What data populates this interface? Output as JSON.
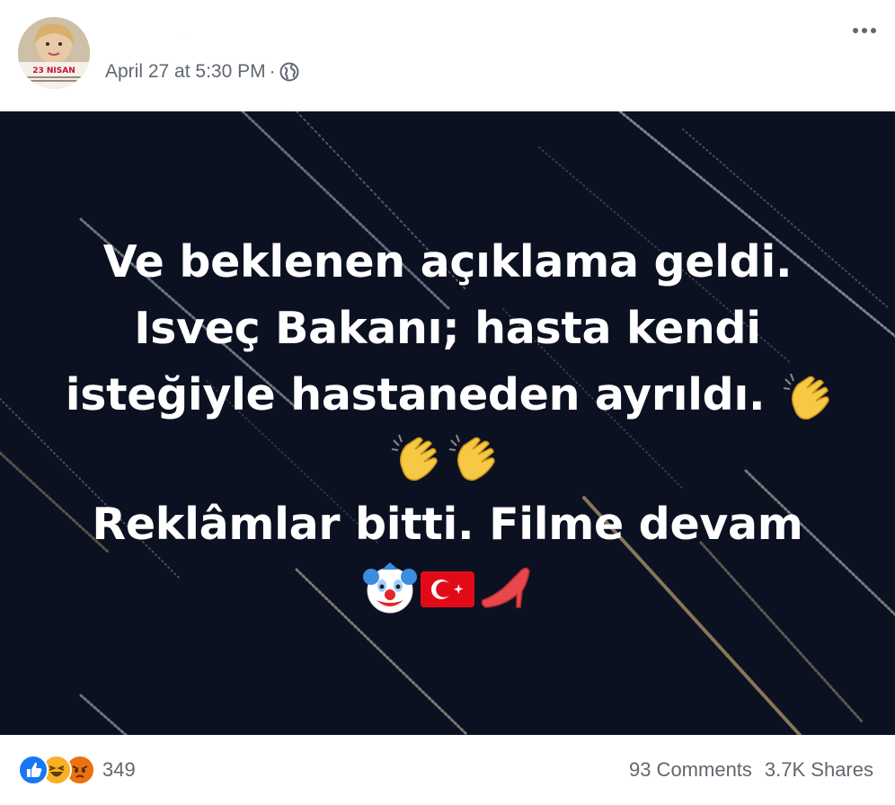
{
  "post": {
    "author_name": "-",
    "timestamp": "April 27 at 5:30 PM",
    "separator": "·",
    "privacy_icon": "globe-icon",
    "avatar_text": "23 NISAN",
    "menu_icon": "more-options-icon"
  },
  "image": {
    "lines": [
      "Ve beklenen açıklama geldi.",
      "Isveç Bakanı; hasta kendi",
      "isteğiyle hastaneden ayrıldı.",
      "Reklâmlar bitti. Filme devam"
    ],
    "emojis": [
      "clapping-hands",
      "clapping-hands",
      "clapping-hands",
      "clown-face",
      "turkey-flag",
      "high-heel"
    ]
  },
  "footer": {
    "reaction_icons": [
      "like-icon",
      "haha-icon",
      "angry-icon"
    ],
    "reaction_count": "349",
    "comments": "93 Comments",
    "shares": "3.7K Shares"
  },
  "colors": {
    "background_dark": "#0c1122",
    "like_blue": "#1877f2",
    "meta_gray": "#606770"
  }
}
